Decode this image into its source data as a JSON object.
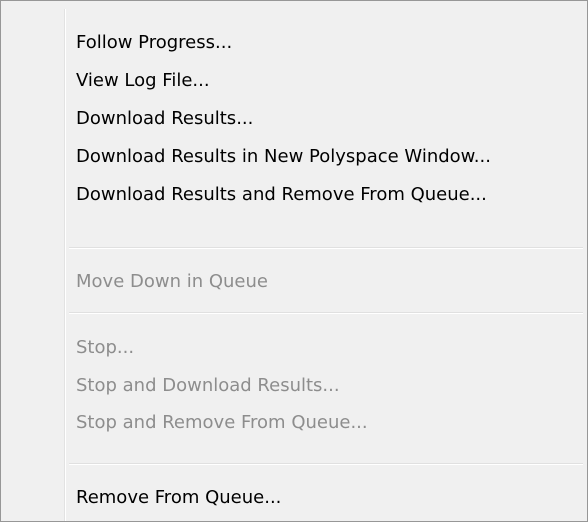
{
  "menu": {
    "items": [
      {
        "label": "Follow Progress...",
        "enabled": true
      },
      {
        "label": "View Log File...",
        "enabled": true
      },
      {
        "label": "Download Results...",
        "enabled": true
      },
      {
        "label": "Download Results in New Polyspace Window...",
        "enabled": true
      },
      {
        "label": "Download Results and Remove From Queue...",
        "enabled": true
      },
      {
        "label": "Move Down in Queue",
        "enabled": false
      },
      {
        "label": "Stop...",
        "enabled": false
      },
      {
        "label": "Stop and Download Results...",
        "enabled": false
      },
      {
        "label": "Stop and Remove From Queue...",
        "enabled": false
      },
      {
        "label": "Remove From Queue...",
        "enabled": true
      }
    ]
  }
}
